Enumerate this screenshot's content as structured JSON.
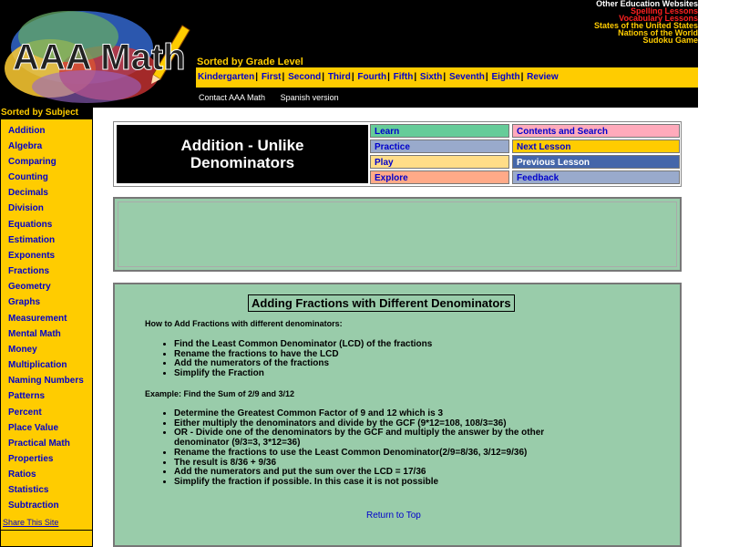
{
  "brand": {
    "logo_text": "AAA Math"
  },
  "external_links": {
    "heading": "Other Education Websites",
    "items": [
      {
        "label": "Spelling Lessons",
        "color": "#ff2020"
      },
      {
        "label": "Vocabulary Lessons",
        "color": "#ff2020"
      },
      {
        "label": "States of the United States",
        "color": "#ffcc00"
      },
      {
        "label": "Nations of the World",
        "color": "#ffcc00"
      },
      {
        "label": "Sudoku Game",
        "color": "#ffcc00"
      }
    ]
  },
  "grade_nav": {
    "caption": "Sorted by Grade Level",
    "items": [
      "Kindergarten",
      "First",
      "Second",
      "Third",
      "Fourth",
      "Fifth",
      "Sixth",
      "Seventh",
      "Eighth",
      "Review"
    ],
    "separator": "|"
  },
  "top_links": [
    "Contact AAA Math",
    "Spanish version"
  ],
  "sidebar": {
    "title": "Sorted by Subject",
    "items": [
      "Addition",
      "Algebra",
      "Comparing",
      "Counting",
      "Decimals",
      "Division",
      "Equations",
      "Estimation",
      "Exponents",
      "Fractions",
      "Geometry",
      "Graphs",
      "Measurement",
      "Mental Math",
      "Money",
      "Multiplication",
      "Naming Numbers",
      "Patterns",
      "Percent",
      "Place Value",
      "Practical Math",
      "Properties",
      "Ratios",
      "Statistics",
      "Subtraction"
    ],
    "share": "Share This Site"
  },
  "lesson": {
    "title_line1": "Addition - Unlike",
    "title_line2": "Denominators",
    "nav": {
      "learn": "Learn",
      "practice": "Practice",
      "play": "Play",
      "explore": "Explore",
      "contents": "Contents and Search",
      "next": "Next Lesson",
      "previous": "Previous Lesson",
      "feedback": "Feedback"
    },
    "nav_colors": {
      "learn": "#66cc99",
      "practice": "#99aacc",
      "play": "#ffdd88",
      "explore": "#ffaa88",
      "contents": "#ffaabb",
      "next": "#ffcc00",
      "previous": "#4466aa",
      "feedback": "#99aacc"
    }
  },
  "content": {
    "title": "Adding Fractions with Different Denominators",
    "how_to_heading": "How to Add Fractions with different denominators:",
    "how_to_steps": [
      "Find the Least Common Denominator (LCD) of the fractions",
      "Rename the fractions to have the LCD",
      "Add the numerators of the fractions",
      "Simplify the Fraction"
    ],
    "example_heading": "Example: Find the Sum of 2/9 and 3/12",
    "example_steps": [
      "Determine the Greatest Common Factor of 9 and 12 which is 3",
      "Either multiply the denominators and divide by the GCF (9*12=108, 108/3=36)",
      "OR - Divide one of the denominators by the GCF and multiply the answer by the other denominator (9/3=3, 3*12=36)",
      "Rename the fractions to use the Least Common Denominator(2/9=8/36, 3/12=9/36)",
      "The result is 8/36 + 9/36",
      "Add the numerators and put the sum over the LCD = 17/36",
      "Simplify the fraction if possible. In this case it is not possible"
    ],
    "return_link": "Return to Top"
  }
}
